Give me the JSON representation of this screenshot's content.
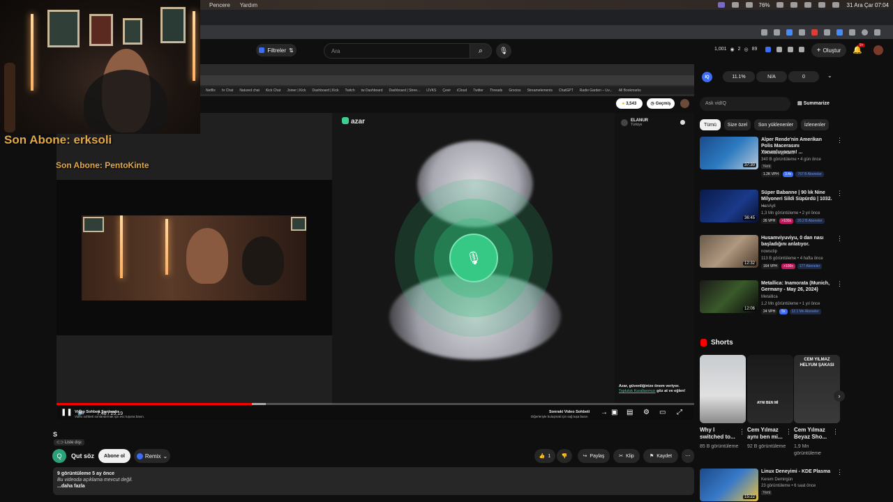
{
  "menubar": {
    "items": [
      "Pencere",
      "Yardım"
    ],
    "battery": "76%",
    "datetime": "31 Ara Çar 07:04"
  },
  "header": {
    "filters_label": "Filtreler",
    "search_placeholder": "Ara",
    "stats": [
      "1,001",
      "2",
      "89"
    ],
    "create_label": "Oluştur",
    "notif_count": "9+"
  },
  "overlay": {
    "last_sub_1": "Son Abone: erksoli",
    "last_sub_2": "Son Abone: PentoKinte"
  },
  "inner_browser": {
    "bookmarks": [
      "Netflix",
      "hr Chat",
      "Natured chat",
      "Kick Chat",
      "Joiner | Kick",
      "Dashboard | Kick",
      "Twitch",
      "tw Dashboard",
      "Dashboard | Stree...",
      "LİVKS",
      "Çevir",
      "iCloud",
      "Twitter",
      "Threads",
      "Grocios",
      "Streamelements",
      "ChatGPT",
      "Radio Garden – Liv...",
      "All Bookmarks"
    ]
  },
  "azar": {
    "logo": "azar",
    "coins": "3,543",
    "history_label": "Geçmiş",
    "partner_name": "ELANUR",
    "partner_country": "Türkiye",
    "safety_text": "Azar, güvenliğinize önem veriyor.",
    "safety_link": "Topluluk Kurallarımızı",
    "safety_tail": "göz at ve eğlen!",
    "next_title": "Sonraki Video Sohbeti",
    "next_sub": "Diğerleriyle buluşmak için sağ tuşa basın",
    "left_title": "Video Sohbeti Sonlandır",
    "left_sub": "Video sohbeti sonlandırmak için esc tuşuna basın."
  },
  "player": {
    "time": "7:48 / 25:19",
    "progress": 0.306,
    "buffered": 0.328
  },
  "video": {
    "title": "S",
    "playlist_badge": "Liste dışı",
    "channel_initial": "Q",
    "channel_name": "Qut söz",
    "subscribe_label": "Abone ol",
    "remix_label": "Remix",
    "likes": "1",
    "share_label": "Paylaş",
    "clip_label": "Klip",
    "save_label": "Kaydet",
    "views_line": "9 görüntüleme  5 ay önce",
    "description": "Bu videoda açıklama mevcut değil.",
    "more_label": "...daha fazla"
  },
  "sidebar": {
    "iq_values": [
      "11.1%",
      "N/A",
      "0"
    ],
    "ask_placeholder": "Ask vidIQ",
    "summarize_label": "Summarize",
    "chips": [
      "Tümü",
      "Size özel",
      "Son yüklenenler",
      "İzlenenler"
    ],
    "related": [
      {
        "title": "Alper Rende'nin Amerikan Polis Macerasını Yorumluyorum! ...",
        "channel": "Amerikalı Aynasız",
        "meta": "340 B görüntüleme • 4 gün önce",
        "extra": "Yeni",
        "duration": "37:30",
        "vph": "1.2K VPH",
        "mult": "3.4x",
        "subs": "767 B Abonelar"
      },
      {
        "title": "Süper Babanne | 90 lık Nine Milyoneri Sildi Süpürdü | 1032. ...",
        "channel": "HanAyli",
        "meta": "1,3 Mn görüntüleme • 2 yıl önce",
        "extra": "",
        "duration": "36:45",
        "vph": "26 VPH",
        "mult": ">100x",
        "subs": "20.2 B Aboneler"
      },
      {
        "title": "Husamviyuviyu, 0 dan nası başladığını anlatıyor.",
        "channel": "nowsclip",
        "meta": "113 B görüntüleme • 4 hafta önce",
        "extra": "",
        "duration": "12:32",
        "vph": "164 VPH",
        "mult": ">100x",
        "subs": "177 Aboneler"
      },
      {
        "title": "Metallica: Inamorata (Munich, Germany - May 26, 2024)",
        "channel": "Metallica",
        "meta": "1,2 Mn görüntüleme • 1 yıl önce",
        "extra": "",
        "duration": "12:06",
        "vph": "24 VPH",
        "mult": "5x",
        "subs": "12.1 Mn Aboneler"
      }
    ],
    "shorts_label": "Shorts",
    "shorts": [
      {
        "title": "Why I switched to...",
        "views": "85 B görüntüleme",
        "caption": ""
      },
      {
        "title": "Cem Yılmaz aynı ben mi...",
        "views": "92 B görüntüleme",
        "caption": "AYNI BEN Mİ"
      },
      {
        "title": "Cem Yılmaz Beyaz Sho...",
        "views": "1,9 Mn görüntüleme",
        "caption": "CEM YILMAZ HELYUM ŞAKASI"
      }
    ],
    "last": {
      "title": "Linux Deneyimi - KDE Plasma",
      "channel": "Kerem Demirgün",
      "meta": "23 görüntüleme • 6 saat önce",
      "extra": "Yeni",
      "duration": "15:22"
    }
  }
}
